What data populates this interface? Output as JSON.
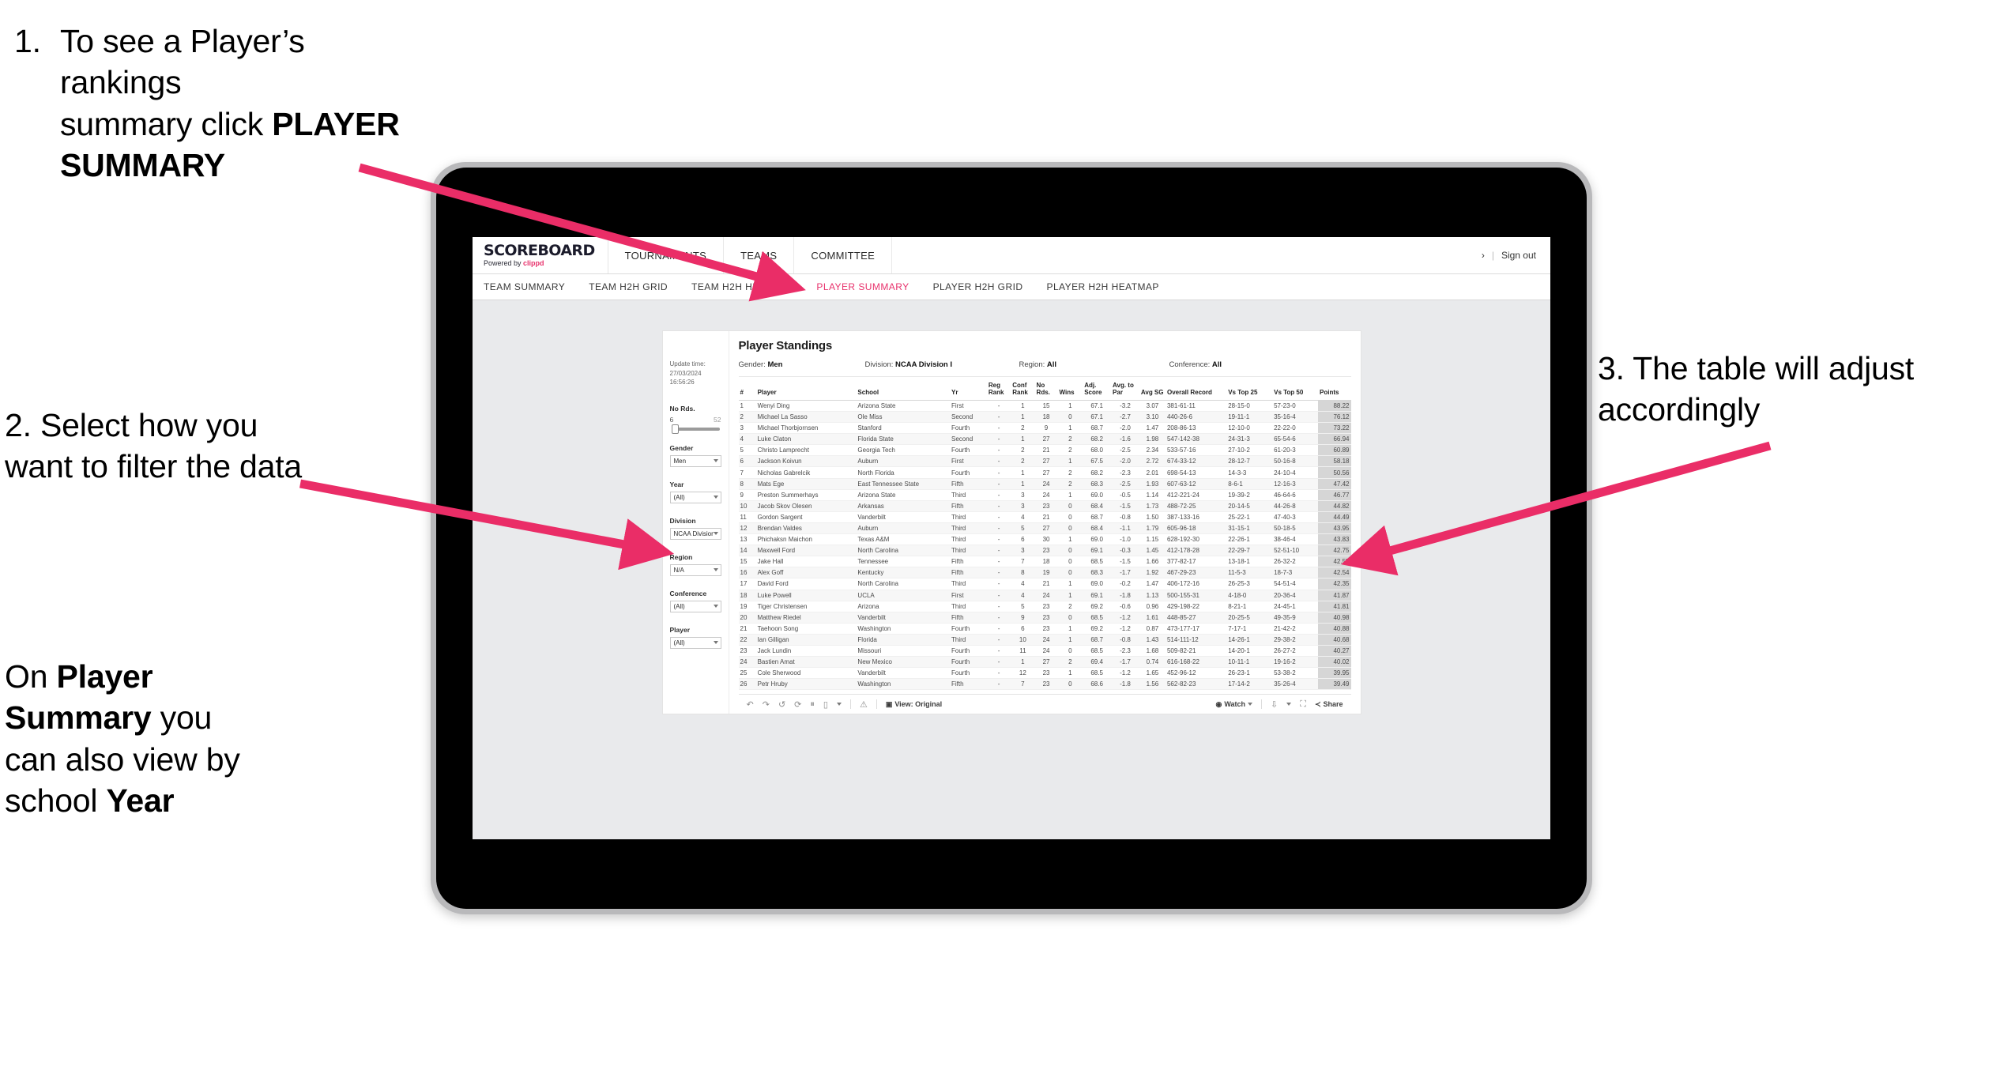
{
  "annotations": {
    "one": {
      "number": "1.",
      "line1": "To see a Player’s rankings",
      "line2_pre": "summary click ",
      "line2_bold": "PLAYER",
      "line3_bold": "SUMMARY"
    },
    "two": {
      "text": "2. Select how you want to filter the data"
    },
    "two_b": {
      "pre": "On ",
      "bold1": "Player Summary",
      "mid": " you can also view by school ",
      "bold2": "Year"
    },
    "three": {
      "text": "3. The table will adjust accordingly"
    }
  },
  "app": {
    "logo": {
      "main": "SCOREBOARD",
      "sub_pre": "Powered by ",
      "sub_brand": "clippd"
    },
    "nav": [
      {
        "label": "TOURNAMENTS"
      },
      {
        "label": "TEAMS"
      },
      {
        "label": "COMMITTEE"
      }
    ],
    "header_right": {
      "user": "›",
      "separator": "|",
      "sign_out": "Sign out"
    },
    "subnav": [
      {
        "label": "TEAM SUMMARY",
        "active": false
      },
      {
        "label": "TEAM H2H GRID",
        "active": false
      },
      {
        "label": "TEAM H2H HEATMAP",
        "active": false
      },
      {
        "label": "PLAYER SUMMARY",
        "active": true
      },
      {
        "label": "PLAYER H2H GRID",
        "active": false
      },
      {
        "label": "PLAYER H2H HEATMAP",
        "active": false
      }
    ],
    "accent_color": "#e8336d"
  },
  "dashboard": {
    "update": {
      "label": "Update time:",
      "value": "27/03/2024 16:56:26"
    },
    "title": "Player Standings",
    "meta": [
      {
        "label": "Gender:",
        "value": "Men"
      },
      {
        "label": "Division:",
        "value": "NCAA Division I"
      },
      {
        "label": "Region:",
        "value": "All"
      },
      {
        "label": "Conference:",
        "value": "All"
      }
    ],
    "filters": {
      "slider": {
        "label": "No Rds.",
        "min": "6",
        "max": "52"
      },
      "selects": [
        {
          "label": "Gender",
          "value": "Men"
        },
        {
          "label": "Year",
          "value": "(All)"
        },
        {
          "label": "Division",
          "value": "NCAA Division I"
        },
        {
          "label": "Region",
          "value": "N/A"
        },
        {
          "label": "Conference",
          "value": "(All)"
        },
        {
          "label": "Player",
          "value": "(All)"
        }
      ]
    },
    "table": {
      "columns": [
        "#",
        "Player",
        "School",
        "Yr",
        "Reg Rank",
        "Conf Rank",
        "No Rds.",
        "Wins",
        "Adj. Score",
        "Avg. to Par",
        "Avg SG",
        "Overall Record",
        "Vs Top 25",
        "Vs Top 50",
        "Points"
      ],
      "rows": [
        [
          "1",
          "Wenyi Ding",
          "Arizona State",
          "First",
          "-",
          "1",
          "15",
          "1",
          "67.1",
          "-3.2",
          "3.07",
          "381-61-11",
          "28-15-0",
          "57-23-0",
          "88.22"
        ],
        [
          "2",
          "Michael La Sasso",
          "Ole Miss",
          "Second",
          "-",
          "1",
          "18",
          "0",
          "67.1",
          "-2.7",
          "3.10",
          "440-26-6",
          "19-11-1",
          "35-16-4",
          "76.12"
        ],
        [
          "3",
          "Michael Thorbjornsen",
          "Stanford",
          "Fourth",
          "-",
          "2",
          "9",
          "1",
          "68.7",
          "-2.0",
          "1.47",
          "208-86-13",
          "12-10-0",
          "22-22-0",
          "73.22"
        ],
        [
          "4",
          "Luke Claton",
          "Florida State",
          "Second",
          "-",
          "1",
          "27",
          "2",
          "68.2",
          "-1.6",
          "1.98",
          "547-142-38",
          "24-31-3",
          "65-54-6",
          "66.94"
        ],
        [
          "5",
          "Christo Lamprecht",
          "Georgia Tech",
          "Fourth",
          "-",
          "2",
          "21",
          "2",
          "68.0",
          "-2.5",
          "2.34",
          "533-57-16",
          "27-10-2",
          "61-20-3",
          "60.89"
        ],
        [
          "6",
          "Jackson Koivun",
          "Auburn",
          "First",
          "-",
          "2",
          "27",
          "1",
          "67.5",
          "-2.0",
          "2.72",
          "674-33-12",
          "28-12-7",
          "50-16-8",
          "58.18"
        ],
        [
          "7",
          "Nicholas Gabrelcik",
          "North Florida",
          "Fourth",
          "-",
          "1",
          "27",
          "2",
          "68.2",
          "-2.3",
          "2.01",
          "698-54-13",
          "14-3-3",
          "24-10-4",
          "50.56"
        ],
        [
          "8",
          "Mats Ege",
          "East Tennessee State",
          "Fifth",
          "-",
          "1",
          "24",
          "2",
          "68.3",
          "-2.5",
          "1.93",
          "607-63-12",
          "8-6-1",
          "12-16-3",
          "47.42"
        ],
        [
          "9",
          "Preston Summerhays",
          "Arizona State",
          "Third",
          "-",
          "3",
          "24",
          "1",
          "69.0",
          "-0.5",
          "1.14",
          "412-221-24",
          "19-39-2",
          "46-64-6",
          "46.77"
        ],
        [
          "10",
          "Jacob Skov Olesen",
          "Arkansas",
          "Fifth",
          "-",
          "3",
          "23",
          "0",
          "68.4",
          "-1.5",
          "1.73",
          "488-72-25",
          "20-14-5",
          "44-26-8",
          "44.82"
        ],
        [
          "11",
          "Gordon Sargent",
          "Vanderbilt",
          "Third",
          "-",
          "4",
          "21",
          "0",
          "68.7",
          "-0.8",
          "1.50",
          "387-133-16",
          "25-22-1",
          "47-40-3",
          "44.49"
        ],
        [
          "12",
          "Brendan Valdes",
          "Auburn",
          "Third",
          "-",
          "5",
          "27",
          "0",
          "68.4",
          "-1.1",
          "1.79",
          "605-96-18",
          "31-15-1",
          "50-18-5",
          "43.95"
        ],
        [
          "13",
          "Phichaksn Maichon",
          "Texas A&M",
          "Third",
          "-",
          "6",
          "30",
          "1",
          "69.0",
          "-1.0",
          "1.15",
          "628-192-30",
          "22-26-1",
          "38-46-4",
          "43.83"
        ],
        [
          "14",
          "Maxwell Ford",
          "North Carolina",
          "Third",
          "-",
          "3",
          "23",
          "0",
          "69.1",
          "-0.3",
          "1.45",
          "412-178-28",
          "22-29-7",
          "52-51-10",
          "42.75"
        ],
        [
          "15",
          "Jake Hall",
          "Tennessee",
          "Fifth",
          "-",
          "7",
          "18",
          "0",
          "68.5",
          "-1.5",
          "1.66",
          "377-82-17",
          "13-18-1",
          "26-32-2",
          "42.55"
        ],
        [
          "16",
          "Alex Goff",
          "Kentucky",
          "Fifth",
          "-",
          "8",
          "19",
          "0",
          "68.3",
          "-1.7",
          "1.92",
          "467-29-23",
          "11-5-3",
          "18-7-3",
          "42.54"
        ],
        [
          "17",
          "David Ford",
          "North Carolina",
          "Third",
          "-",
          "4",
          "21",
          "1",
          "69.0",
          "-0.2",
          "1.47",
          "406-172-16",
          "26-25-3",
          "54-51-4",
          "42.35"
        ],
        [
          "18",
          "Luke Powell",
          "UCLA",
          "First",
          "-",
          "4",
          "24",
          "1",
          "69.1",
          "-1.8",
          "1.13",
          "500-155-31",
          "4-18-0",
          "20-36-4",
          "41.87"
        ],
        [
          "19",
          "Tiger Christensen",
          "Arizona",
          "Third",
          "-",
          "5",
          "23",
          "2",
          "69.2",
          "-0.6",
          "0.96",
          "429-198-22",
          "8-21-1",
          "24-45-1",
          "41.81"
        ],
        [
          "20",
          "Matthew Riedel",
          "Vanderbilt",
          "Fifth",
          "-",
          "9",
          "23",
          "0",
          "68.5",
          "-1.2",
          "1.61",
          "448-85-27",
          "20-25-5",
          "49-35-9",
          "40.98"
        ],
        [
          "21",
          "Taehoon Song",
          "Washington",
          "Fourth",
          "-",
          "6",
          "23",
          "1",
          "69.2",
          "-1.2",
          "0.87",
          "473-177-17",
          "7-17-1",
          "21-42-2",
          "40.88"
        ],
        [
          "22",
          "Ian Gilligan",
          "Florida",
          "Third",
          "-",
          "10",
          "24",
          "1",
          "68.7",
          "-0.8",
          "1.43",
          "514-111-12",
          "14-26-1",
          "29-38-2",
          "40.68"
        ],
        [
          "23",
          "Jack Lundin",
          "Missouri",
          "Fourth",
          "-",
          "11",
          "24",
          "0",
          "68.5",
          "-2.3",
          "1.68",
          "509-82-21",
          "14-20-1",
          "26-27-2",
          "40.27"
        ],
        [
          "24",
          "Bastien Amat",
          "New Mexico",
          "Fourth",
          "-",
          "1",
          "27",
          "2",
          "69.4",
          "-1.7",
          "0.74",
          "616-168-22",
          "10-11-1",
          "19-16-2",
          "40.02"
        ],
        [
          "25",
          "Cole Sherwood",
          "Vanderbilt",
          "Fourth",
          "-",
          "12",
          "23",
          "1",
          "68.5",
          "-1.2",
          "1.65",
          "452-96-12",
          "26-23-1",
          "53-38-2",
          "39.95"
        ],
        [
          "26",
          "Petr Hruby",
          "Washington",
          "Fifth",
          "-",
          "7",
          "23",
          "0",
          "68.6",
          "-1.8",
          "1.56",
          "562-82-23",
          "17-14-2",
          "35-26-4",
          "39.49"
        ]
      ]
    },
    "toolbar": {
      "left_icons": [
        "undo-icon",
        "redo-icon",
        "revert-icon",
        "refresh-icon",
        "pause-icon",
        "chevron-down-icon"
      ],
      "alert_icon": "alert-icon",
      "view_label": "View: Original",
      "watch_label": "Watch",
      "share_label": "Share"
    }
  }
}
